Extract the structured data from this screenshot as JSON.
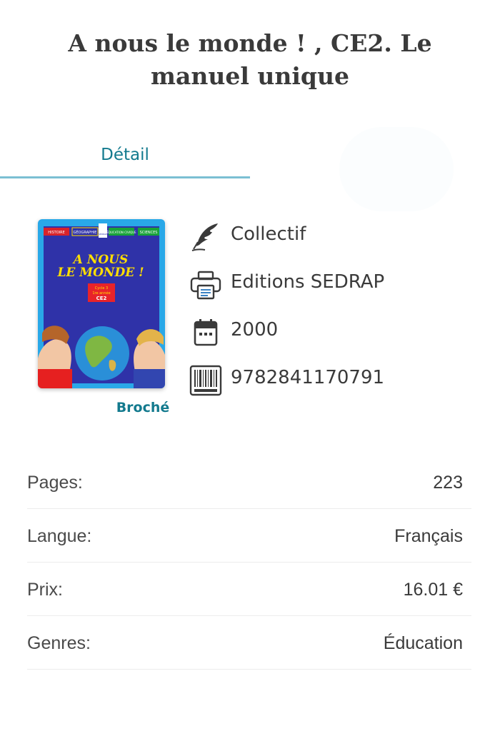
{
  "book": {
    "title": "A nous le monde ! , CE2. Le manuel unique",
    "format": "Broché"
  },
  "tabs": {
    "detail_label": "Détail"
  },
  "cover": {
    "top_bar": [
      "HISTOIRE",
      "GÉOGRAPHIE",
      "ÉDUCATION CIVIQUE",
      "SCIENCES"
    ],
    "publisher_logo": "SEDRAP",
    "headline_1": "A NOUS",
    "headline_2": "LE MONDE !",
    "label_line_1": "Cycle 3",
    "label_line_2": "1re année",
    "label_level": "CE2",
    "background_color": "#2f32a8",
    "frame_color": "#29a8e8"
  },
  "meta": {
    "author": "Collectif",
    "author_icon": "quill-pen-icon",
    "publisher": "Editions SEDRAP",
    "publisher_icon": "printer-icon",
    "year": "2000",
    "year_icon": "calendar-icon",
    "isbn": "9782841170791",
    "isbn_icon": "barcode-icon"
  },
  "specs": [
    {
      "label": "Pages:",
      "value": "223"
    },
    {
      "label": "Langue:",
      "value": "Français"
    },
    {
      "label": "Prix:",
      "value": "16.01 €"
    },
    {
      "label": "Genres:",
      "value": "Éducation"
    }
  ],
  "colors": {
    "accent": "#137a8e",
    "tab_underline": "#7bbfd3"
  }
}
